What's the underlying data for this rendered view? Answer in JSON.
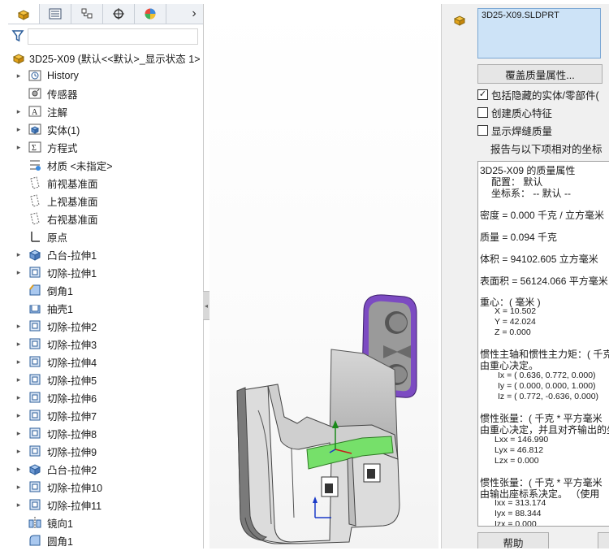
{
  "tree_root": {
    "label": "3D25-X09  (默认<<默认>_显示状态 1>"
  },
  "tree_items": [
    {
      "label": "History",
      "icon": "history-icon",
      "expandable": true
    },
    {
      "label": "传感器",
      "icon": "sensor-icon",
      "expandable": false
    },
    {
      "label": "注解",
      "icon": "annotation-icon",
      "expandable": true
    },
    {
      "label": "实体(1)",
      "icon": "solid-bodies-icon",
      "expandable": true
    },
    {
      "label": "方程式",
      "icon": "equations-icon",
      "expandable": true
    },
    {
      "label": "材质 <未指定>",
      "icon": "material-icon",
      "expandable": false
    },
    {
      "label": "前视基准面",
      "icon": "plane-icon",
      "expandable": false
    },
    {
      "label": "上视基准面",
      "icon": "plane-icon",
      "expandable": false
    },
    {
      "label": "右视基准面",
      "icon": "plane-icon",
      "expandable": false
    },
    {
      "label": "原点",
      "icon": "origin-icon",
      "expandable": false
    },
    {
      "label": "凸台-拉伸1",
      "icon": "boss-extrude-icon",
      "expandable": true
    },
    {
      "label": "切除-拉伸1",
      "icon": "cut-extrude-icon",
      "expandable": true
    },
    {
      "label": "倒角1",
      "icon": "chamfer-icon",
      "expandable": false
    },
    {
      "label": "抽壳1",
      "icon": "shell-icon",
      "expandable": false
    },
    {
      "label": "切除-拉伸2",
      "icon": "cut-extrude-icon",
      "expandable": true
    },
    {
      "label": "切除-拉伸3",
      "icon": "cut-extrude-icon",
      "expandable": true
    },
    {
      "label": "切除-拉伸4",
      "icon": "cut-extrude-icon",
      "expandable": true
    },
    {
      "label": "切除-拉伸5",
      "icon": "cut-extrude-icon",
      "expandable": true
    },
    {
      "label": "切除-拉伸6",
      "icon": "cut-extrude-icon",
      "expandable": true
    },
    {
      "label": "切除-拉伸7",
      "icon": "cut-extrude-icon",
      "expandable": true
    },
    {
      "label": "切除-拉伸8",
      "icon": "cut-extrude-icon",
      "expandable": true
    },
    {
      "label": "切除-拉伸9",
      "icon": "cut-extrude-icon",
      "expandable": true
    },
    {
      "label": "凸台-拉伸2",
      "icon": "boss-extrude-icon",
      "expandable": true
    },
    {
      "label": "切除-拉伸10",
      "icon": "cut-extrude-icon",
      "expandable": true
    },
    {
      "label": "切除-拉伸11",
      "icon": "cut-extrude-icon",
      "expandable": true
    },
    {
      "label": "镜向1",
      "icon": "mirror-icon",
      "expandable": false
    },
    {
      "label": "圆角1",
      "icon": "fillet-icon",
      "expandable": false
    }
  ],
  "mass_props": {
    "selection_item": "3D25-X09.SLDPRT",
    "override_button": "覆盖质量属性...",
    "include_hidden": "包括隐藏的实体/零部件(",
    "create_com": "创建质心特征",
    "show_weld": "显示焊缝质量",
    "report_label": "报告与以下项相对的坐标",
    "help_button": "帮助",
    "results": {
      "title": "3D25-X09 的质量属性",
      "config": "配置：  默认",
      "coordsys": "坐标系：  -- 默认 --",
      "density": "密度 = 0.000 千克 / 立方毫米",
      "mass": "质量 = 0.094 千克",
      "volume": "体积 = 94102.605 立方毫米",
      "surface": "表面积 = 56124.066  平方毫米",
      "com_head": "重心：( 毫米 )",
      "com_x": "X = 10.502",
      "com_y": "Y = 42.024",
      "com_z": "Z = 0.000",
      "principal_head": "惯性主轴和惯性主力矩：( 千克",
      "principal_sub": "由重心决定。",
      "ix": "Ix = ( 0.636,  0.772,  0.000)",
      "iy": "Iy = ( 0.000,  0.000,  1.000)",
      "iz": "Iz = ( 0.772, -0.636,  0.000)",
      "tensor_com_head": "惯性张量：( 千克 * 平方毫米",
      "tensor_com_sub": "由重心决定，并且对齐输出的坐",
      "lxx": "Lxx = 146.990",
      "lyx": "Lyx = 46.812",
      "lzx": "Lzx = 0.000",
      "tensor_out_head": "惯性张量：( 千克 * 平方毫米",
      "tensor_out_sub": "由输出座标系决定。  （使用",
      "ixx": "Ixx = 313.174",
      "iyx": "Iyx = 88.344",
      "izx": "Izx = 0.000"
    }
  },
  "colors": {
    "accent_purple": "#6a3aa8",
    "face_green": "#76e06a",
    "part_gray": "#8f8f8f",
    "selection_blue": "#cde3f7"
  }
}
